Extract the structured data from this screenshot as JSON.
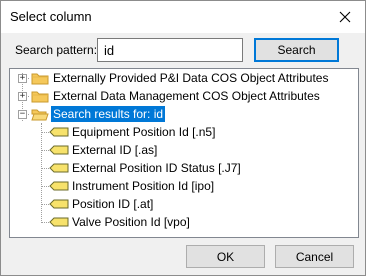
{
  "window": {
    "title": "Select column"
  },
  "search": {
    "label": "Search pattern:",
    "value": "id",
    "button": "Search"
  },
  "tree": {
    "roots": [
      {
        "label": "Externally Provided P&I Data COS Object Attributes",
        "expander": "+"
      },
      {
        "label": "External Data Management COS Object Attributes",
        "expander": "+"
      },
      {
        "label": "Search results for: id",
        "expander": "−"
      }
    ],
    "results": [
      "Equipment Position Id [.n5]",
      "External ID [.as]",
      "External Position ID Status [.J7]",
      "Instrument Position Id [ipo]",
      "Position ID [.at]",
      "Valve Position Id [vpo]"
    ]
  },
  "footer": {
    "ok": "OK",
    "cancel": "Cancel"
  },
  "colors": {
    "selection": "#0078d7",
    "folder": "#f5c85a",
    "tag": "#f7e26b"
  }
}
